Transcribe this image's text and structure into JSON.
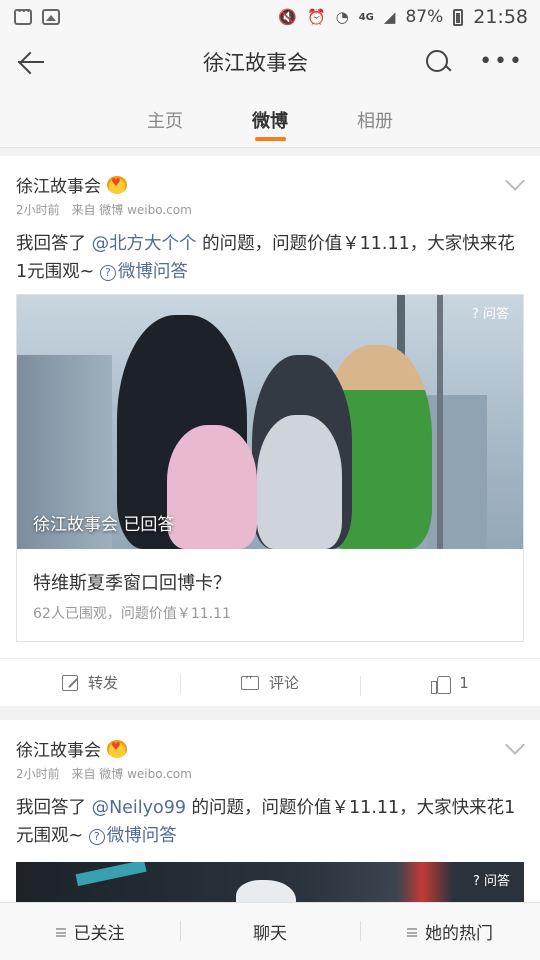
{
  "status_bar": {
    "battery": "87%",
    "time": "21:58",
    "network": "4G"
  },
  "nav": {
    "title": "徐江故事会"
  },
  "tabs": [
    {
      "label": "主页",
      "active": false
    },
    {
      "label": "微博",
      "active": true
    },
    {
      "label": "相册",
      "active": false
    }
  ],
  "posts": [
    {
      "author": "徐江故事会",
      "time": "2小时前",
      "source": "来自 微博 weibo.com",
      "text_prefix": "我回答了 ",
      "mention": "@北方大个个",
      "text_suffix": " 的问题，问题价值￥11.11，大家快来花1元围观~ ",
      "qa_link": "微博问答",
      "qa_tag": "问答",
      "answered_label": "徐江故事会 已回答",
      "question": "特维斯夏季窗口回博卡？",
      "stats": "62人已围观，问题价值￥11.11",
      "actions": {
        "repost": "转发",
        "comment": "评论",
        "like": "1"
      }
    },
    {
      "author": "徐江故事会",
      "time": "2小时前",
      "source": "来自 微博 weibo.com",
      "text_prefix": "我回答了 ",
      "mention": "@Neilyo99",
      "text_suffix": " 的问题，问题价值￥11.11，大家快来花1元围观~ ",
      "qa_link": "微博问答",
      "qa_tag": "问答"
    }
  ],
  "bottom_bar": {
    "followed": "已关注",
    "chat": "聊天",
    "hot": "她的热门"
  },
  "colors": {
    "accent": "#f87d1e",
    "link": "#506b95"
  }
}
